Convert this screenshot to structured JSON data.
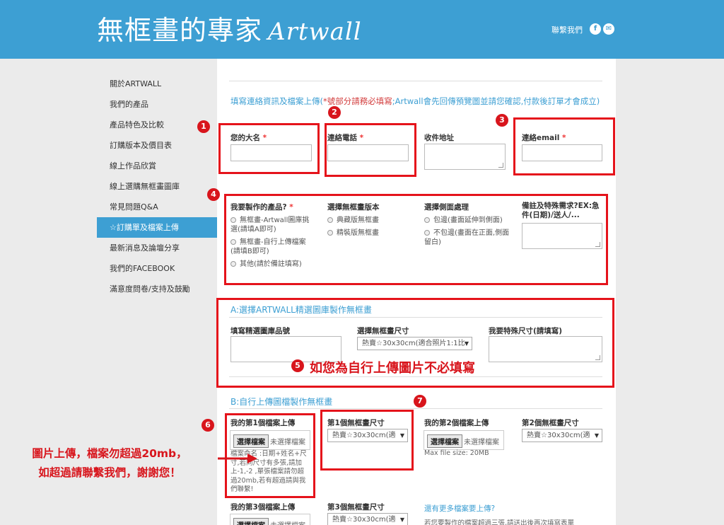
{
  "header": {
    "logo_cn": "無框畫的專家",
    "logo_en": "Artwall",
    "contact": "聯繫我們",
    "icons": [
      "facebook-icon",
      "email-icon"
    ]
  },
  "sidebar": {
    "items": [
      {
        "label": "關於ARTWALL",
        "active": false
      },
      {
        "label": "我們的產品",
        "active": false
      },
      {
        "label": "產品特色及比較",
        "active": false
      },
      {
        "label": "訂購版本及價目表",
        "active": false
      },
      {
        "label": "線上作品欣賞",
        "active": false
      },
      {
        "label": "線上選購無框畫圖庫",
        "active": false
      },
      {
        "label": "常見問題Q&A",
        "active": false
      },
      {
        "label": "☆訂購單及檔案上傳",
        "active": true
      },
      {
        "label": "最新消息及論壇分享",
        "active": false
      },
      {
        "label": "我們的FACEBOOK",
        "active": false
      },
      {
        "label": "滿意度問卷/支持及鼓勵",
        "active": false
      }
    ]
  },
  "form": {
    "intro_a": "填寫連絡資訊及檔案上傳(",
    "intro_warn": "*號部分請務必填寫",
    "intro_b": ";Artwall會先回傳預覽圖並請您確認,付款後訂單才會成立)",
    "contact_fields": {
      "name_label": "您的大名",
      "phone_label": "連絡電話",
      "address_label": "收件地址",
      "email_label": "連絡email",
      "required_mark": "*"
    },
    "product": {
      "label": "我要製作的產品?",
      "options": [
        "無框畫-Artwall圖庫挑選(請填A即可)",
        "無框畫-自行上傳檔案(請填B即可)",
        "其他(請於備註填寫)"
      ]
    },
    "version": {
      "label": "選擇無框畫版本",
      "options": [
        "典藏版無框畫",
        "精裝版無框畫"
      ]
    },
    "side": {
      "label": "選擇側面處理",
      "options": [
        "包邊(畫面延伸到側面)",
        "不包邊(畫面在正面,側面留白)"
      ]
    },
    "notes": {
      "label": "備註及特殊需求?EX:急件(日期)/送人/..."
    },
    "section_a": {
      "title": "A:選擇ARTWALL精選圖庫製作無框畫",
      "code_label": "填寫精選圖庫品號",
      "size_label": "選擇無框畫尺寸",
      "size_value": "熱賣☆30x30cm(適合照片1:1比",
      "special_label": "我要特殊尺寸(請填寫)"
    },
    "section_b": {
      "title": "B:自行上傳圖檔製作無框畫",
      "file1_label": "我的第1個檔案上傳",
      "file2_label": "我的第2個檔案上傳",
      "file3_label": "我的第3個檔案上傳",
      "file_button": "選擇檔案",
      "file_none": "未選擇檔案",
      "file_note": "檔案命名 :日期+姓名+尺寸,若同尺寸有多張,請加上-1,-2 ,單張檔案請勿超過20mb,若有超過請與我們聯繫!",
      "max_size": "Max file size: 20MB",
      "size1_label": "第1個無框畫尺寸",
      "size2_label": "第2個無框畫尺寸",
      "size3_label": "第3個無框畫尺寸",
      "size_value": "熱賣☆30x30cm(適",
      "more_link": "還有更多檔案要上傳?",
      "more_text": "若您要製作的檔案超過三張,請送出後再次填寫表單"
    }
  },
  "annotations": {
    "badges": [
      "1",
      "2",
      "3",
      "4",
      "5",
      "6",
      "7"
    ],
    "note5": "如您為自行上傳圖片不必填寫",
    "side_note_line1": "圖片上傳，檔案勿超過20mb，",
    "side_note_line2": "如超過請聯繫我們，謝謝您！",
    "color": "#d8151c"
  }
}
